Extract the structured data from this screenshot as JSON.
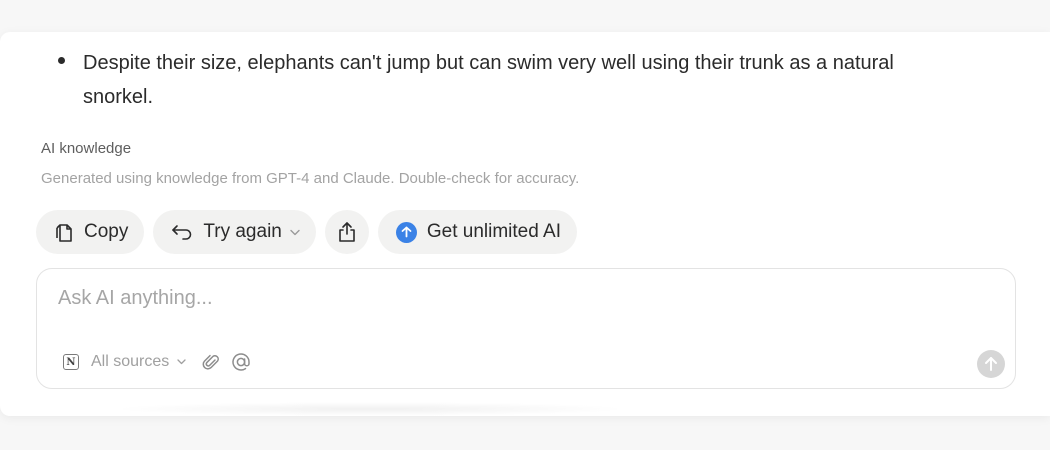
{
  "message": {
    "bullet_text": "Despite their size, elephants can't jump but can swim very well using their trunk as a natural snorkel."
  },
  "source": {
    "title": "AI knowledge",
    "description": "Generated using knowledge from GPT-4 and Claude. Double-check for accuracy."
  },
  "actions": {
    "copy_label": "Copy",
    "try_again_label": "Try again",
    "upgrade_label": "Get unlimited AI"
  },
  "composer": {
    "placeholder": "Ask AI anything...",
    "sources_label": "All sources"
  },
  "colors": {
    "accent": "#3b82e6",
    "pill_bg": "#f2f2f1",
    "send_disabled": "#d6d6d6"
  },
  "icons": [
    "copy-icon",
    "undo-arrow-icon",
    "chevron-down-icon",
    "share-icon",
    "arrow-up-icon",
    "notion-icon",
    "paperclip-icon",
    "at-icon",
    "send-icon"
  ]
}
